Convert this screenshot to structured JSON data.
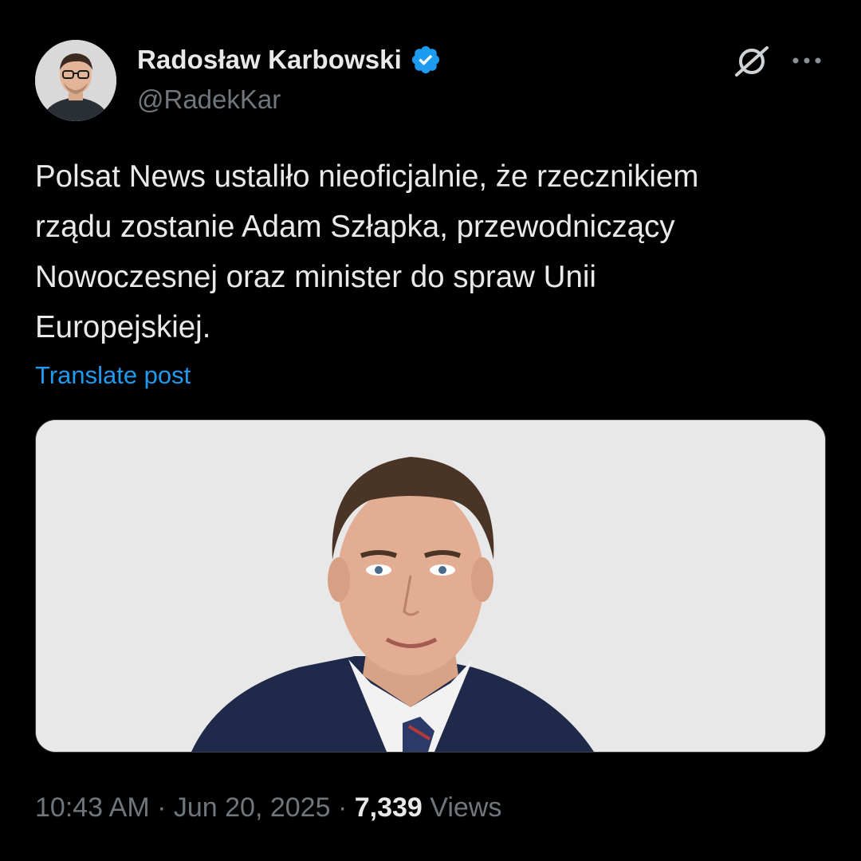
{
  "author": {
    "display_name": "Radosław Karbowski",
    "handle": "@RadekKar",
    "verified_icon": "verified-badge-icon"
  },
  "header_actions": {
    "grok_icon": "grok-icon",
    "more_icon": "more-options-icon"
  },
  "post": {
    "text": "Polsat News ustaliło nieoficjalnie, że rzecznikiem\nrządu zostanie Adam Szłapka, przewodniczący\nNowoczesnej oraz minister do spraw Unii\nEuropejskiej.",
    "translate_label": "Translate post"
  },
  "meta": {
    "time": "10:43 AM",
    "sep1": " · ",
    "date": "Jun 20, 2025",
    "sep2": " · ",
    "views_count": "7,339",
    "views_label": " Views"
  },
  "colors": {
    "background": "#000000",
    "text_primary": "#e7e9ea",
    "text_secondary": "#71767b",
    "link": "#1d9bf0",
    "verified": "#1d9bf0"
  }
}
